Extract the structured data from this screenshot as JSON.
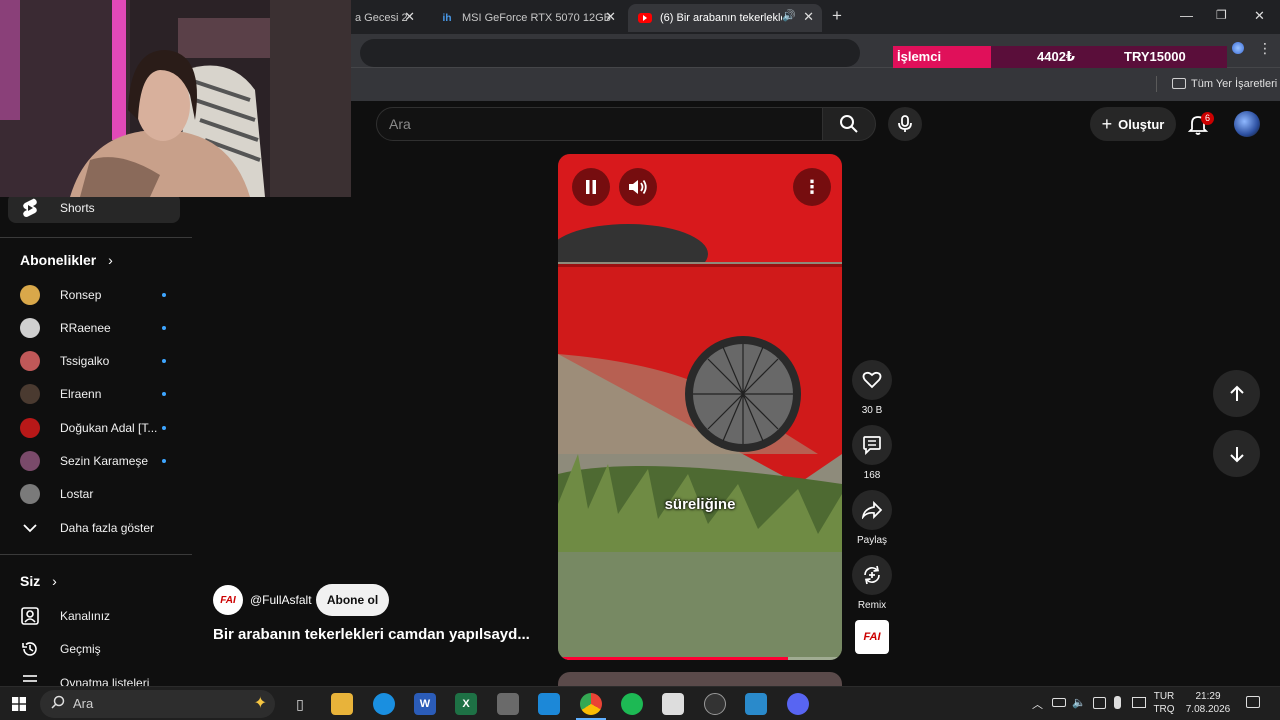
{
  "browser": {
    "tabs": [
      {
        "label": "a Gecesi 2"
      },
      {
        "label": "MSI GeForce RTX 5070 12GB VE"
      },
      {
        "label": "(6) Bir arabanın tekerlekleri"
      }
    ],
    "new_tab": "+",
    "bookmarks_all": "Tüm Yer İşaretleri"
  },
  "ticker": {
    "label": "İşlemci",
    "price": "4402₺",
    "goal": "TRY15000"
  },
  "youtube": {
    "search_placeholder": "Ara",
    "create_label": "Oluştur",
    "notification_count": "6"
  },
  "sidebar": {
    "shorts_label": "Shorts",
    "subscriptions_title": "Abonelikler",
    "channels": [
      {
        "name": "Ronsep",
        "color": "#d9a84a"
      },
      {
        "name": "RRaenee",
        "color": "#cfcfcf"
      },
      {
        "name": "Tssigalko",
        "color": "#c05858"
      },
      {
        "name": "Elraenn",
        "color": "#4a3a30"
      },
      {
        "name": "Doğukan Adal [T...",
        "color": "#b81818"
      },
      {
        "name": "Sezin Karameşe",
        "color": "#7a4a6a"
      },
      {
        "name": "Lostar",
        "color": "#7a7a7a"
      }
    ],
    "show_more": "Daha fazla göster",
    "you_title": "Siz",
    "you_items": [
      {
        "label": "Kanalınız"
      },
      {
        "label": "Geçmiş"
      },
      {
        "label": "Oynatma listeleri"
      }
    ]
  },
  "short": {
    "caption": "süreliğine",
    "progress_fraction": 0.81,
    "likes": "30 B",
    "comments": "168",
    "share_label": "Paylaş",
    "remix_label": "Remix",
    "channel_logo_text": "FAI",
    "channel_handle": "@FullAsfalt",
    "subscribe_label": "Abone ol",
    "title": "Bir arabanın tekerlekleri camdan yapılsayd..."
  },
  "taskbar": {
    "search_placeholder": "Ara",
    "language": "TUR",
    "layout": "TRQ",
    "time": "21:29",
    "date": "7.08.2026"
  }
}
